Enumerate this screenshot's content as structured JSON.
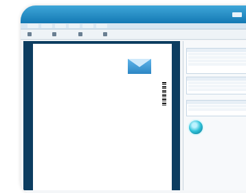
{
  "app": {
    "title_tag": "",
    "tabs": [
      "",
      "",
      "",
      "",
      "",
      ""
    ]
  },
  "toolbar": {
    "items": [
      {
        "label": ""
      },
      {
        "label": ""
      },
      {
        "label": ""
      },
      {
        "label": ""
      }
    ]
  },
  "document": {
    "sender_lines": [
      "",
      "",
      "",
      ""
    ],
    "recipient_lines": [
      "",
      "",
      ""
    ],
    "meta_left": [
      "",
      "",
      ""
    ],
    "meta_right": [
      "",
      "",
      ""
    ],
    "subject": "",
    "salutation": "",
    "items": [
      {
        "label": "",
        "value": ""
      },
      {
        "label": "",
        "value": ""
      },
      {
        "label": "",
        "value": ""
      },
      {
        "label": "",
        "value": ""
      },
      {
        "label": "",
        "value": ""
      },
      {
        "label": "",
        "value": ""
      },
      {
        "label": "",
        "value": ""
      },
      {
        "label": "",
        "value": ""
      },
      {
        "label": "",
        "value": ""
      }
    ]
  },
  "side_panel": {
    "header": "",
    "panels": [
      {
        "title": "",
        "rows": [
          "",
          "",
          "",
          ""
        ]
      },
      {
        "title": "",
        "rows": [
          "",
          "",
          ""
        ]
      },
      {
        "title": "",
        "rows": [
          "",
          ""
        ]
      }
    ],
    "send_label": ""
  },
  "colors": {
    "accent_blue": "#1479b4",
    "doc_bg": "#0c3d60",
    "button_teal": "#2ec1d8"
  }
}
